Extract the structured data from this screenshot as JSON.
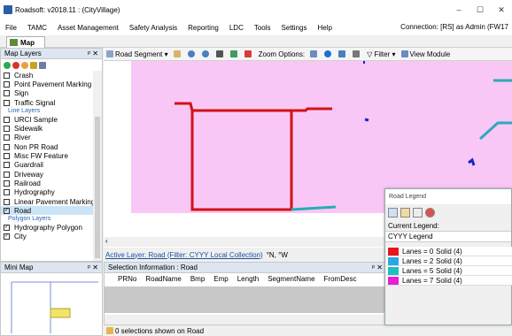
{
  "window": {
    "title": "Roadsoft: v2018.11  : (CityVillage)",
    "min": "–",
    "max": "☐",
    "close": "✕"
  },
  "menu": [
    "File",
    "TAMC",
    "Asset Management",
    "Safety Analysis",
    "Reporting",
    "LDC",
    "Tools",
    "Settings",
    "Help"
  ],
  "connection": "Connection: [RS] as Admin (FW17",
  "doc_tab": "Map",
  "map_layers": {
    "title": "Map Layers",
    "pin": "ᵖ ✕",
    "items": [
      {
        "label": "Crash",
        "checked": false
      },
      {
        "label": "Point Pavement Marking",
        "checked": false
      },
      {
        "label": "Sign",
        "checked": false
      },
      {
        "label": "Traffic Signal",
        "checked": false
      }
    ],
    "line_group": "Line Layers",
    "line_items": [
      {
        "label": "URCI Sample",
        "checked": false
      },
      {
        "label": "Sidewalk",
        "checked": false
      },
      {
        "label": "River",
        "checked": false
      },
      {
        "label": "Non PR Road",
        "checked": false
      },
      {
        "label": "Misc FW Feature",
        "checked": false
      },
      {
        "label": "Guardrail",
        "checked": false
      },
      {
        "label": "Driveway",
        "checked": false
      },
      {
        "label": "Railroad",
        "checked": false
      },
      {
        "label": "Hydrography",
        "checked": false
      },
      {
        "label": "Linear Pavement Marking",
        "checked": false
      },
      {
        "label": "Road",
        "checked": true
      }
    ],
    "polygon_group": "Polygon Layers",
    "polygon_items": [
      {
        "label": "Hydrography Polygon",
        "checked": true
      },
      {
        "label": "City",
        "checked": true
      }
    ]
  },
  "mini_map": {
    "title": "Mini Map",
    "pin": "ᵖ ✕"
  },
  "toolbar": {
    "road_segment": "Road Segment",
    "zoom_options": "Zoom Options:",
    "filter": "Filter",
    "view_module": "View Module"
  },
  "active_layer": {
    "link": "Active Layer: Road (Filter: CYYY Local Collection)",
    "coords": "°N, °W"
  },
  "selection": {
    "title": "Selection Information : Road",
    "pin": "ᵖ ✕",
    "columns": [
      "PRNo",
      "RoadName",
      "Bmp",
      "Emp",
      "Length",
      "SegmentName",
      "FromDesc"
    ]
  },
  "status": "0 selections shown on Road",
  "road_legend": {
    "title": "Road Legend",
    "current_label": "Current Legend:",
    "current_value": "CYYY Legend",
    "rows": [
      {
        "color": "#e8141e",
        "lanes": "Lanes = 0",
        "style": "Solid (4)"
      },
      {
        "color": "#2aa6e8",
        "lanes": "Lanes = 2",
        "style": "Solid (4)"
      },
      {
        "color": "#1dbfbf",
        "lanes": "Lanes = 5",
        "style": "Solid (4)"
      },
      {
        "color": "#e51ed8",
        "lanes": "Lanes = 7",
        "style": "Solid (4)"
      }
    ]
  },
  "colors": {
    "map_fill": "#f9c7f6",
    "road_red": "#d21212",
    "road_teal": "#2aabb8",
    "marker_blue": "#1228c8"
  }
}
